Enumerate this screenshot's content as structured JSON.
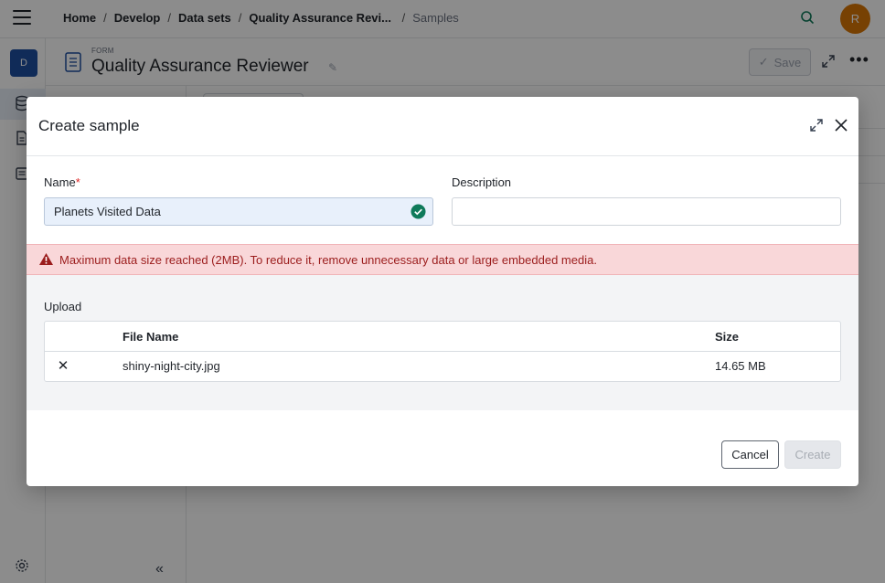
{
  "topbar": {
    "menu_icon": "hamburger-menu-icon",
    "breadcrumb": [
      "Home",
      "Develop",
      "Data sets",
      "Quality Assurance Revi...",
      "Samples"
    ],
    "search_icon": "search-icon",
    "avatar_initial": "R",
    "avatar_color": "#d97706"
  },
  "leftrail": {
    "workspace_initial": "D",
    "icons": [
      "database-icon",
      "document-icon",
      "form-list-icon",
      "settings-gear-icon"
    ]
  },
  "form_header": {
    "kicker": "FORM",
    "title": "Quality Assurance Reviewer",
    "save_label": "Save"
  },
  "modal": {
    "title": "Create sample",
    "name_label": "Name",
    "required_marker": "*",
    "name_value": "Planets Visited Data",
    "description_label": "Description",
    "description_value": "",
    "alert_text": "Maximum data size reached (2MB). To reduce it, remove unnecessary data or large embedded media.",
    "upload_label": "Upload",
    "table": {
      "columns": [
        "File Name",
        "Size"
      ],
      "rows": [
        {
          "file_name": "shiny-night-city.jpg",
          "size": "14.65 MB"
        }
      ]
    },
    "cancel_label": "Cancel",
    "create_label": "Create"
  },
  "colors": {
    "accent_blue": "#1e4fa1",
    "success_green": "#0f7a5a",
    "error_red": "#9b1c1c",
    "error_bg": "#f9d7d9"
  }
}
